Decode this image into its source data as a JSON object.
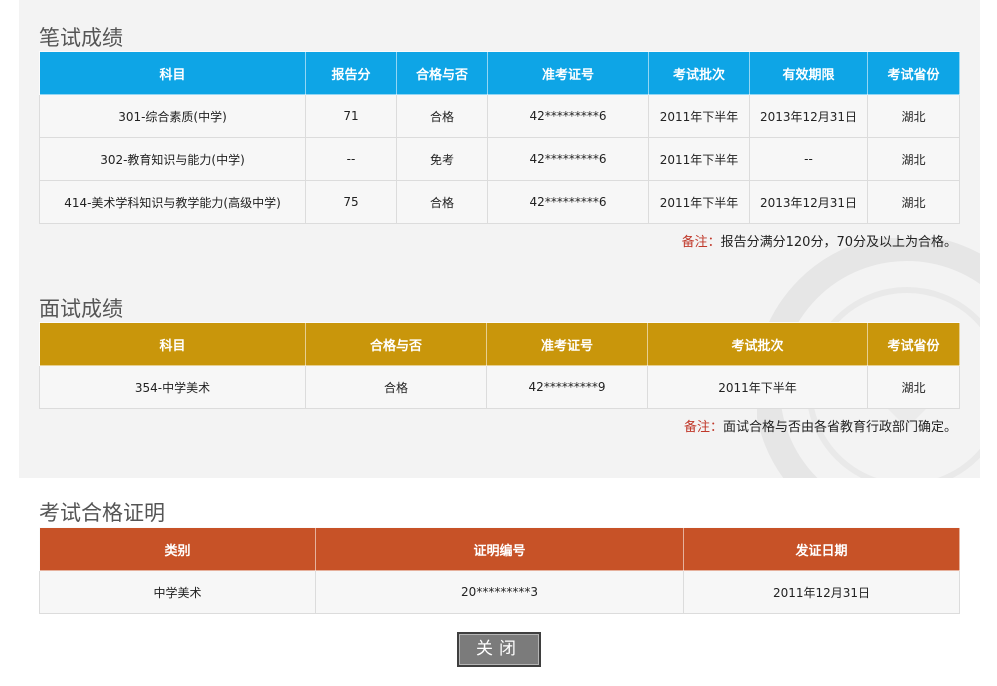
{
  "written": {
    "title": "笔试成绩",
    "headers": [
      "科目",
      "报告分",
      "合格与否",
      "准考证号",
      "考试批次",
      "有效期限",
      "考试省份"
    ],
    "rows": [
      [
        "301-综合素质(中学)",
        "71",
        "合格",
        "42*********6",
        "2011年下半年",
        "2013年12月31日",
        "湖北"
      ],
      [
        "302-教育知识与能力(中学)",
        "--",
        "免考",
        "42*********6",
        "2011年下半年",
        "--",
        "湖北"
      ],
      [
        "414-美术学科知识与教学能力(高级中学)",
        "75",
        "合格",
        "42*********6",
        "2011年下半年",
        "2013年12月31日",
        "湖北"
      ]
    ],
    "note_label": "备注：",
    "note_text": "报告分满分120分，70分及以上为合格。"
  },
  "interview": {
    "title": "面试成绩",
    "headers": [
      "科目",
      "合格与否",
      "准考证号",
      "考试批次",
      "考试省份"
    ],
    "rows": [
      [
        "354-中学美术",
        "合格",
        "42*********9",
        "2011年下半年",
        "湖北"
      ]
    ],
    "note_label": "备注：",
    "note_text": "面试合格与否由各省教育行政部门确定。"
  },
  "certificate": {
    "title": "考试合格证明",
    "headers": [
      "类别",
      "证明编号",
      "发证日期"
    ],
    "rows": [
      [
        "中学美术",
        "20*********3",
        "2011年12月31日"
      ]
    ]
  },
  "close_label": "关闭",
  "colors": {
    "written_header": "#0ea5e6",
    "interview_header": "#c9960b",
    "certificate_header": "#c75227",
    "note_label": "#c0392b"
  }
}
